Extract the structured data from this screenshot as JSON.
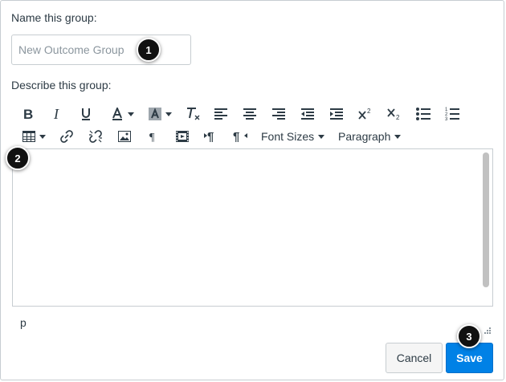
{
  "form": {
    "name_label": "Name this group:",
    "name_placeholder": "New Outcome Group",
    "describe_label": "Describe this group:"
  },
  "toolbar": {
    "row1": [
      "bold-icon",
      "italic-icon",
      "underline-icon",
      "text-color-icon",
      "background-color-icon",
      "clear-formatting-icon",
      "align-left-icon",
      "align-center-icon",
      "align-right-icon",
      "outdent-icon",
      "indent-icon",
      "superscript-icon",
      "subscript-icon",
      "bullet-list-icon",
      "numbered-list-icon"
    ],
    "row2": [
      "table-icon",
      "link-icon",
      "unlink-icon",
      "image-icon",
      "paragraph-mark-icon",
      "media-icon",
      "ltr-icon",
      "rtl-icon"
    ],
    "font_sizes_label": "Font Sizes",
    "paragraph_label": "Paragraph"
  },
  "editor": {
    "path_text": "p"
  },
  "buttons": {
    "cancel_label": "Cancel",
    "save_label": "Save"
  },
  "callouts": [
    "1",
    "2",
    "3"
  ],
  "colors": {
    "accent": "#0081e6",
    "text": "#2d3b45",
    "border": "#c7cdd1",
    "callout": "#111111"
  }
}
